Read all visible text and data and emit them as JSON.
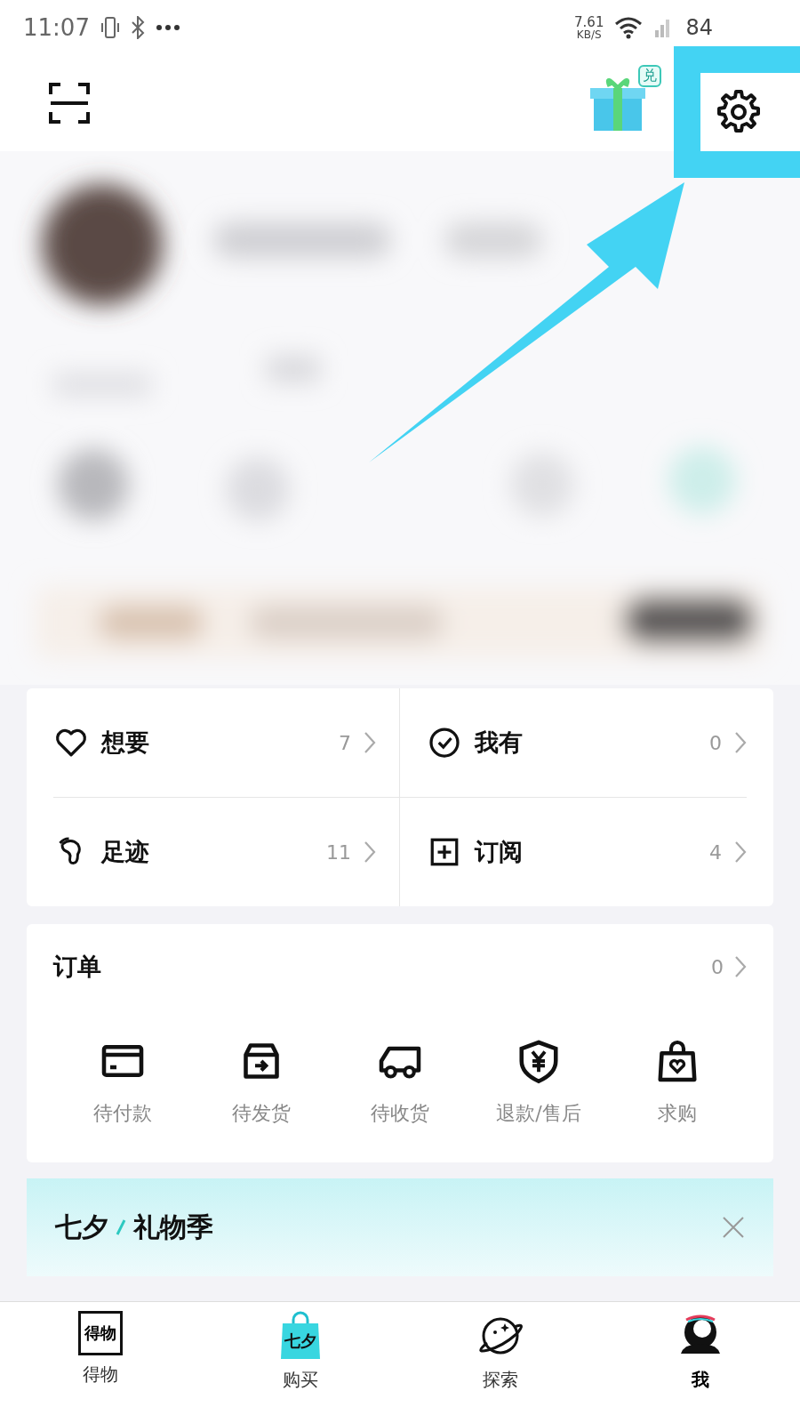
{
  "status_bar": {
    "time": "11:07",
    "speed_value": "7.61",
    "speed_unit": "KB/S",
    "battery": "84"
  },
  "header": {
    "gift_badge": "兑"
  },
  "quick_links": [
    {
      "label": "想要",
      "count": "7",
      "kind": "heart"
    },
    {
      "label": "我有",
      "count": "0",
      "kind": "check"
    },
    {
      "label": "足迹",
      "count": "11",
      "kind": "foot"
    },
    {
      "label": "订阅",
      "count": "4",
      "kind": "plus"
    }
  ],
  "orders": {
    "title": "订单",
    "count": "0",
    "items": [
      {
        "label": "待付款",
        "kind": "card"
      },
      {
        "label": "待发货",
        "kind": "box"
      },
      {
        "label": "待收货",
        "kind": "truck"
      },
      {
        "label": "退款/售后",
        "kind": "shield"
      },
      {
        "label": "求购",
        "kind": "bag"
      }
    ]
  },
  "banner": {
    "title_left": "七夕",
    "title_right": "礼物季"
  },
  "tab_bar": [
    {
      "label": "得物",
      "icon_text": "得物",
      "kind": "logo",
      "selected": false
    },
    {
      "label": "购买",
      "icon_text": "七夕",
      "kind": "bag",
      "selected": false
    },
    {
      "label": "探索",
      "kind": "planet",
      "selected": false
    },
    {
      "label": "我",
      "kind": "avatar",
      "selected": true
    }
  ]
}
